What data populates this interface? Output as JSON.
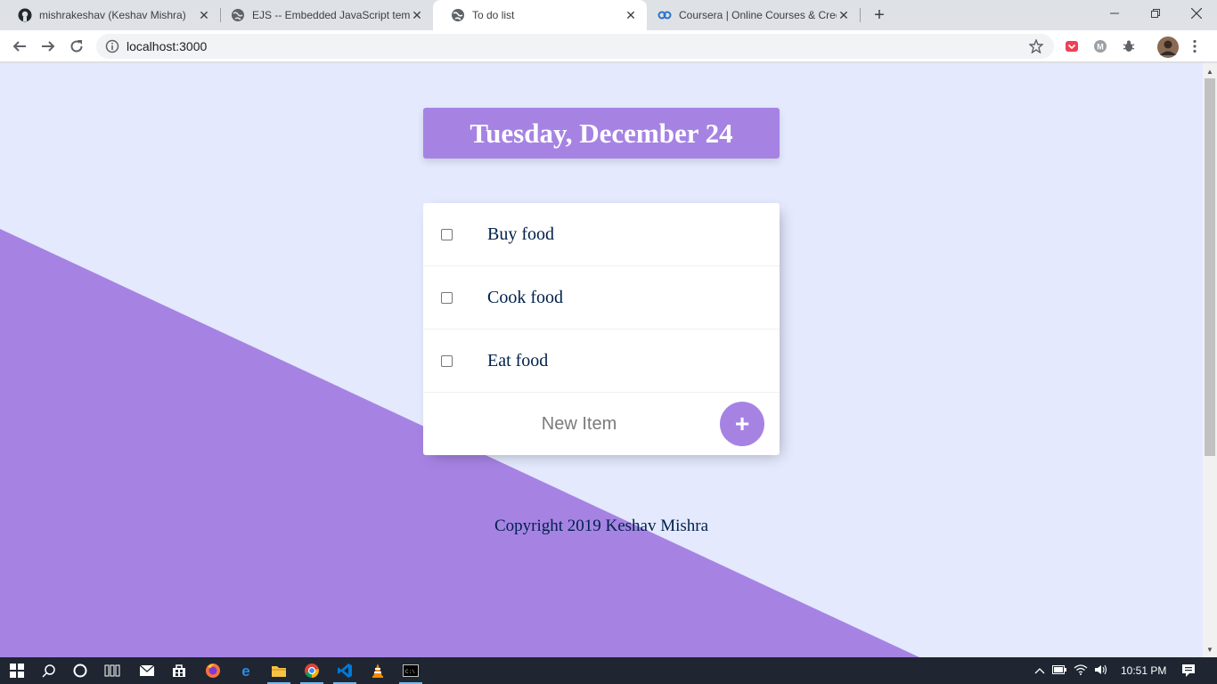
{
  "browser": {
    "tabs": [
      {
        "title": "mishrakeshav (Keshav Mishra)",
        "icon": "github-icon"
      },
      {
        "title": "EJS -- Embedded JavaScript templates",
        "icon": "globe-icon"
      },
      {
        "title": "To do list",
        "icon": "globe-icon"
      },
      {
        "title": "Coursera | Online Courses & Credentials",
        "icon": "coursera-icon"
      }
    ],
    "address": "localhost:3000"
  },
  "page": {
    "heading": "Tuesday, December 24",
    "items": [
      {
        "label": "Buy food",
        "checked": false
      },
      {
        "label": "Cook food",
        "checked": false
      },
      {
        "label": "Eat food",
        "checked": false
      }
    ],
    "new_item_placeholder": "New Item",
    "add_button_label": "+",
    "footer_prefix": "Copyright 2019 ",
    "footer_name": "Keshav Mishra",
    "colors": {
      "accent": "#a683e3",
      "background": "#e4e9fd",
      "text": "#00204a"
    }
  },
  "taskbar": {
    "time": "10:51 PM"
  }
}
